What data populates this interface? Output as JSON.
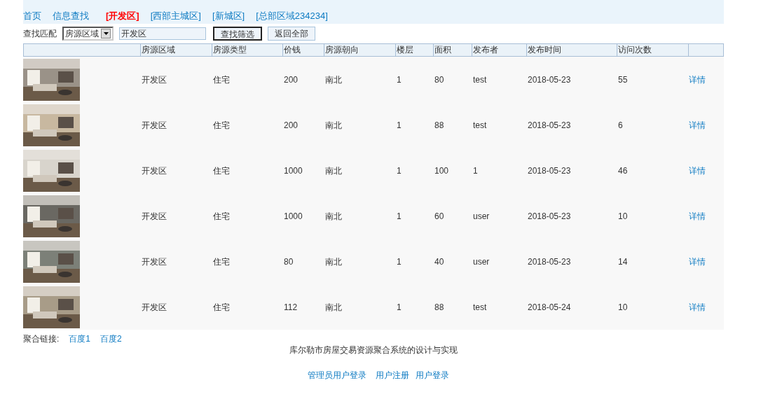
{
  "nav": [
    {
      "label": "首页",
      "selected": false
    },
    {
      "label": "信息查找",
      "selected": false
    },
    {
      "label": "[开发区]",
      "selected": true
    },
    {
      "label": "[西部主城区]",
      "selected": false
    },
    {
      "label": "[新城区]",
      "selected": false
    },
    {
      "label": "[总部区域234234]",
      "selected": false
    }
  ],
  "search": {
    "label": "查找匹配",
    "select_value": "房源区域",
    "value": "开发区",
    "buttons": [
      {
        "label": "查找筛选",
        "selected": true
      },
      {
        "label": "返回全部",
        "selected": false
      }
    ]
  },
  "table": {
    "columns": [
      "房源区域",
      "房源类型",
      "价钱",
      "房源朝向",
      "楼层",
      "面积",
      "发布者",
      "发布时间",
      "访问次数"
    ],
    "rows": [
      {
        "cells": [
          "开发区",
          "住宅",
          "200",
          "南北",
          "1",
          "80",
          "test",
          "2018-05-23",
          "55"
        ],
        "link": "详情"
      },
      {
        "cells": [
          "开发区",
          "住宅",
          "200",
          "南北",
          "1",
          "88",
          "test",
          "2018-05-23",
          "6"
        ],
        "link": "详情"
      },
      {
        "cells": [
          "开发区",
          "住宅",
          "1000",
          "南北",
          "1",
          "100",
          "1",
          "2018-05-23",
          "46"
        ],
        "link": "详情"
      },
      {
        "cells": [
          "开发区",
          "住宅",
          "1000",
          "南北",
          "1",
          "60",
          "user",
          "2018-05-23",
          "10"
        ],
        "link": "详情"
      },
      {
        "cells": [
          "开发区",
          "住宅",
          "80",
          "南北",
          "1",
          "40",
          "user",
          "2018-05-23",
          "14"
        ],
        "link": "详情"
      },
      {
        "cells": [
          "开发区",
          "住宅",
          "112",
          "南北",
          "1",
          "88",
          "test",
          "2018-05-24",
          "10"
        ],
        "link": "详情"
      }
    ]
  },
  "links": {
    "label": "聚合链接:",
    "items": [
      "百度1",
      "百度2"
    ]
  },
  "footer": {
    "title": "库尔勒市房屋交易资源聚合系统的设计与实现",
    "links": [
      "管理员用户登录",
      "用户注册",
      "用户登录"
    ]
  }
}
